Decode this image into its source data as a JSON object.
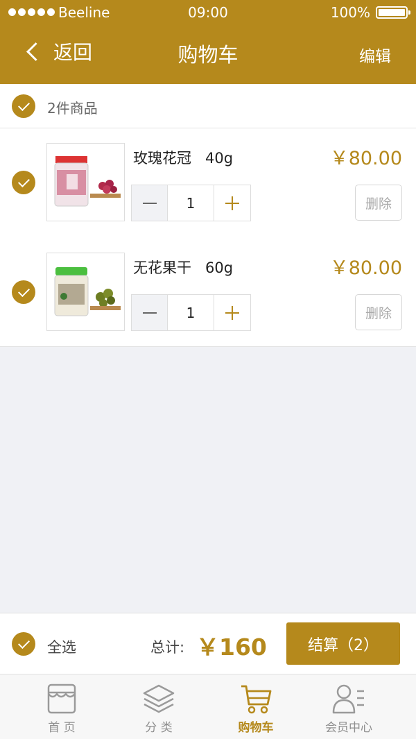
{
  "status_bar": {
    "carrier": "Beeline",
    "time": "09:00",
    "battery": "100%"
  },
  "nav": {
    "back_label": "返回",
    "title": "购物车",
    "edit_label": "编辑"
  },
  "cart": {
    "count_label": "2件商品",
    "items": [
      {
        "name": "玫瑰花冠   40g",
        "price": "￥80.00",
        "quantity": "1",
        "delete_label": "删除"
      },
      {
        "name": "无花果干   60g",
        "price": "￥80.00",
        "quantity": "1",
        "delete_label": "删除"
      }
    ]
  },
  "footer": {
    "select_all_label": "全选",
    "total_label": "总计:",
    "total_value": "￥160",
    "checkout_label": "结算（2）"
  },
  "tabbar": {
    "tabs": [
      {
        "label": "首 页",
        "icon": "store-icon"
      },
      {
        "label": "分 类",
        "icon": "layers-icon"
      },
      {
        "label": "购物车",
        "icon": "cart-icon",
        "active": true
      },
      {
        "label": "会员中心",
        "icon": "user-list-icon"
      }
    ]
  },
  "colors": {
    "accent": "#b5891c",
    "background": "#f0f1f5"
  }
}
